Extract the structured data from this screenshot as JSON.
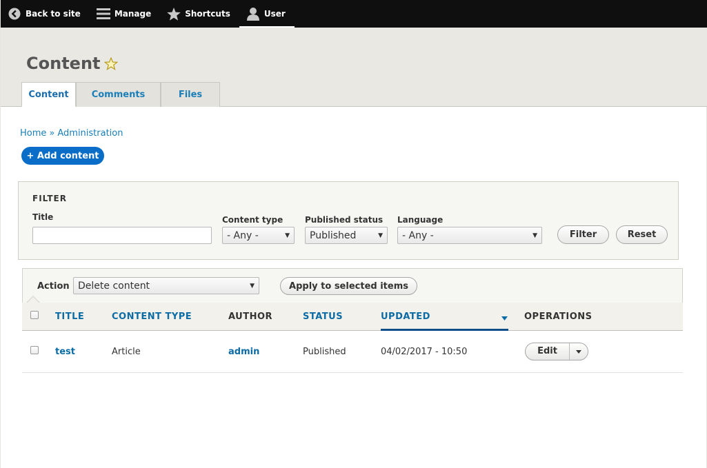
{
  "toolbar": {
    "back_label": "Back to site",
    "manage_label": "Manage",
    "shortcuts_label": "Shortcuts",
    "user_label": "User"
  },
  "header": {
    "title": "Content",
    "tabs": [
      {
        "label": "Content"
      },
      {
        "label": "Comments"
      },
      {
        "label": "Files"
      }
    ]
  },
  "breadcrumb": {
    "home": "Home",
    "separator": "»",
    "admin": "Administration"
  },
  "add_content_label": "+ Add content",
  "filter": {
    "legend": "FILTER",
    "title_label": "Title",
    "title_value": "",
    "content_type_label": "Content type",
    "content_type_value": "- Any -",
    "status_label": "Published status",
    "status_value": "Published",
    "language_label": "Language",
    "language_value": "- Any -",
    "filter_button": "Filter",
    "reset_button": "Reset"
  },
  "action": {
    "label": "Action",
    "selected": "Delete content",
    "apply_button": "Apply to selected items"
  },
  "table": {
    "headers": {
      "title": "TITLE",
      "content_type": "CONTENT TYPE",
      "author": "AUTHOR",
      "status": "STATUS",
      "updated": "UPDATED",
      "operations": "OPERATIONS"
    },
    "rows": [
      {
        "title": "test",
        "content_type": "Article",
        "author": "admin",
        "status": "Published",
        "updated": "04/02/2017 - 10:50",
        "operation": "Edit"
      }
    ]
  },
  "colors": {
    "toolbar_bg": "#0f0f0f",
    "header_bg": "#e9e8e3",
    "link": "#1a7fb9",
    "primary_button": "#0a6dc7",
    "star": "#f2d94e"
  }
}
